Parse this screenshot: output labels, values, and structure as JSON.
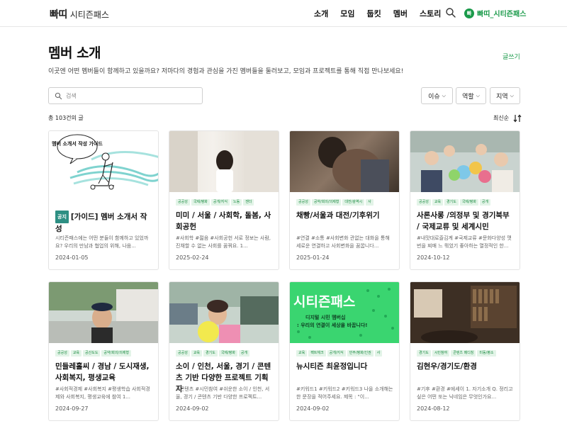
{
  "header": {
    "logo_mark": "빠띠",
    "logo_sub": "시티즌패스",
    "nav": [
      "소개",
      "모임",
      "둡킷",
      "멤버",
      "스토리"
    ],
    "user_initial": "빠",
    "user_name": "빠띠_시티즌패스"
  },
  "page": {
    "title": "멤버 소개",
    "write_label": "글쓰기",
    "description": "이곳엔 어떤 멤버들이 함께하고 있을까요? 저마다의 경험과 관심을 가진 멤버들을 둘러보고, 모임과 프로젝트를 통해 직접 만나보세요!"
  },
  "search": {
    "placeholder": "검색"
  },
  "filters": [
    "이슈",
    "역할",
    "지역"
  ],
  "list": {
    "count_text": "총 103건의 글",
    "sort_label": "최신순"
  },
  "colors": {
    "accent": "#1a9a4a",
    "tag_bg": "#e3f4e8",
    "tag_text": "#1a8a40",
    "badge": "#2d8f83"
  },
  "cards": [
    {
      "badge": "공지",
      "tags": [],
      "title": "[가이드] 멤버 소개서 작성",
      "excerpt": "시티즌패스에는 어떤 분들이 함께하고 있었까요? 우리의 만남과 협업의 위해, 나음...",
      "date": "2024-01-05",
      "thumb_text": "멤버 소개서 작성 가이드"
    },
    {
      "tags": [
        "공공성",
        "국제/평화",
        "공개/지식",
        "노동",
        "젠더"
      ],
      "title": "미미 / 서울 / 사회학, 돌봄, 사회공헌",
      "excerpt": "#사회학 #젊음 #사회공헌 서로 정보는 사람, 진채할 수 없는 사회를 꿈꿔요. 1...",
      "date": "2025-02-24"
    },
    {
      "tags": [
        "공공성",
        "공약/회의/의제형",
        "대전/광역시",
        "사"
      ],
      "title": "채빵/서울과 대전/기후위기",
      "excerpt": "#연결 #소통 #사회변화 관없는 대화을 통해 세로운 연결하고 사회변화을 꿈꿉니다...",
      "date": "2025-01-24"
    },
    {
      "tags": [
        "공공성",
        "교육",
        "경기도",
        "국제/평화",
        "공개"
      ],
      "title": "사론사롱 /의정부 및 경기북부 / 국제교류 및 세계시민",
      "excerpt": "#내맛대로즐김계 #국제교류 #문화다양성 맷번을 찌매 느 뭐었기 좋아하는 열정적인 한...",
      "date": "2024-10-12"
    },
    {
      "tags": [
        "공공성",
        "교육",
        "공산도도",
        "공약/회의/의제형"
      ],
      "title": "민들레홀씨 / 경남 / 도시재생, 사회복지, 평생교육",
      "excerpt": "#사회적경제 #사회복지 #평생학습 사회적경제와 사회복지, 평생교육에 참여 1...",
      "date": "2024-09-27"
    },
    {
      "tags": [
        "공공성",
        "교육",
        "경기도",
        "국제/평화",
        "공개"
      ],
      "title": "소이 / 인천, 서울, 경기 / 콘텐츠 기반 다양한 프로젝트 기획자",
      "excerpt": "#콘텐츠 #시민참여 #쉬운한 소이 / 인천, 서울, 경기 / 콘텐츠 기반 다양한 프로젝트...",
      "date": "2024-09-02"
    },
    {
      "tags": [
        "교육",
        "펙트체크",
        "공개/지식",
        "민주/평화/인권",
        "사"
      ],
      "title": "뉴시티즌 최윤정입니다",
      "excerpt": "#키워드1 #키워드2 #키워드3 나을 소개해는 한 문장을 적어주세요. 제목 : \"이...",
      "date": "2024-09-02",
      "thumb_title": "시티즌패스",
      "thumb_line1": "디지털 시민 멤버십",
      "thumb_line2": ": 우리의 연결이 세상을 바꿉니다!"
    },
    {
      "tags": [
        "경기도",
        "시민참여",
        "콘텐츠 메디칭",
        "미동/평소"
      ],
      "title": "김현우/경기도/환경",
      "excerpt": "#기후 #환경 #에세이 1. 자기소개 Q. 정리고 싶은 어떤 또는 닉네임은 무엇인가요...",
      "date": "2024-08-12"
    }
  ]
}
